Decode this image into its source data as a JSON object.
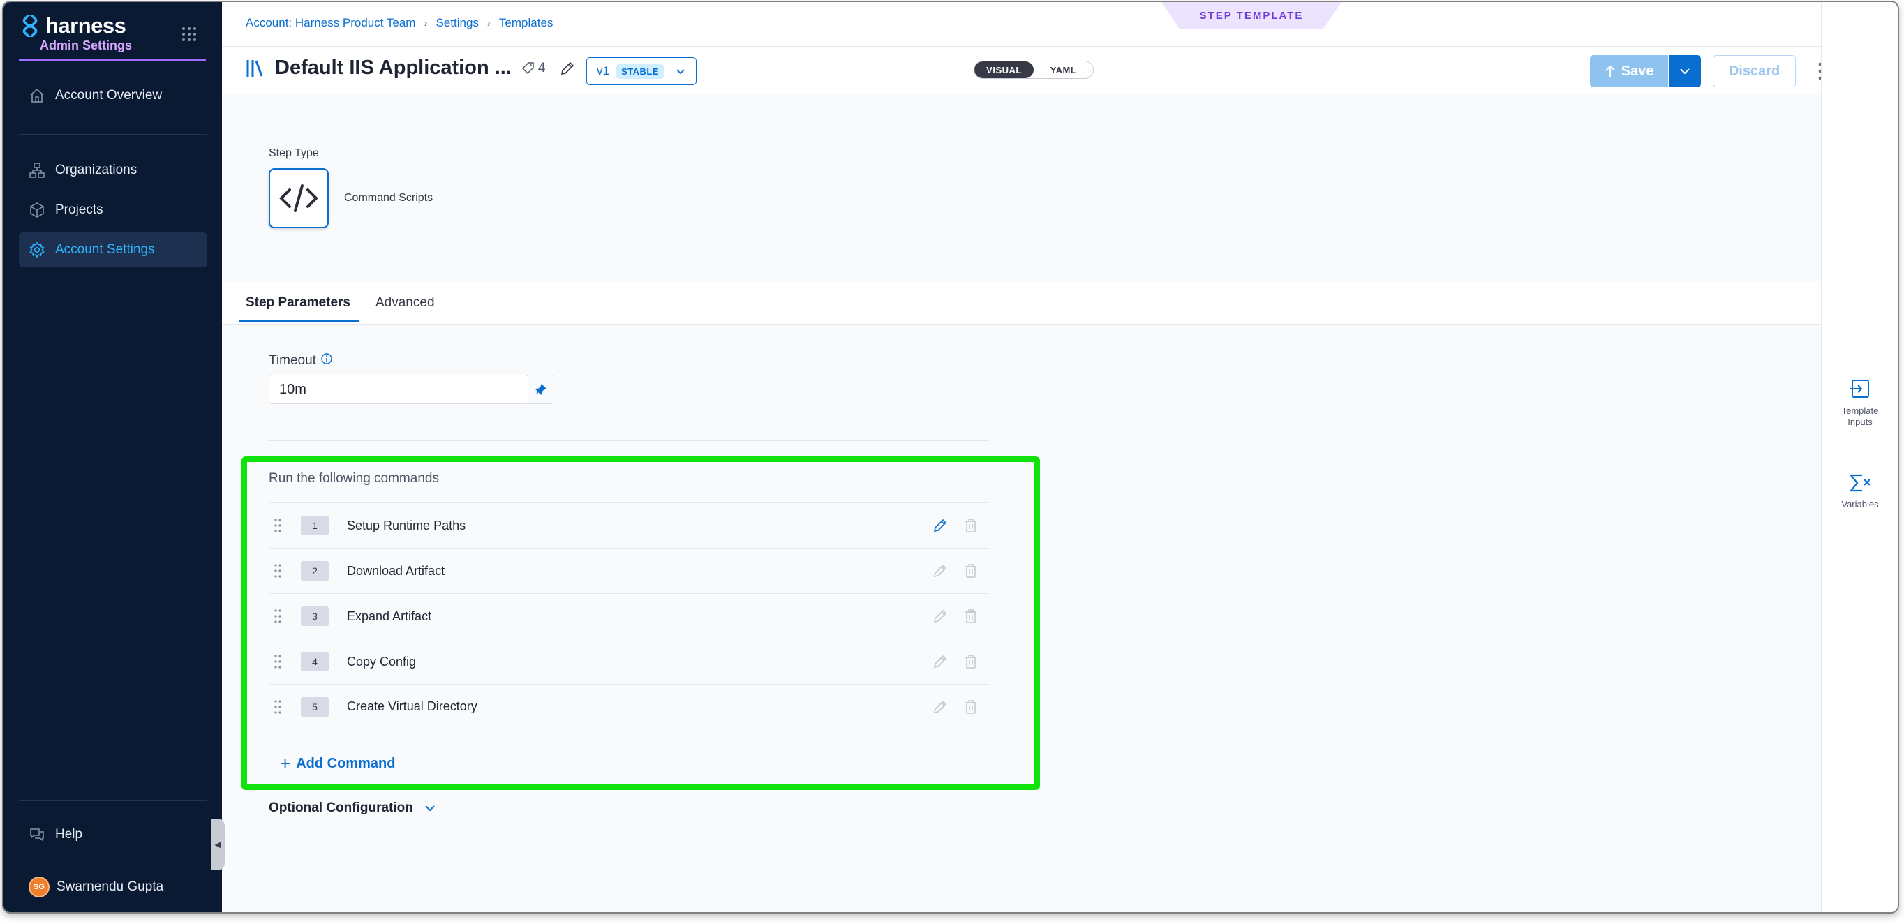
{
  "sidebar": {
    "logo_text": "harness",
    "admin_label": "Admin Settings",
    "items": [
      {
        "label": "Account Overview",
        "icon": "home-icon"
      },
      {
        "label": "Organizations",
        "icon": "org-icon"
      },
      {
        "label": "Projects",
        "icon": "cube-icon"
      },
      {
        "label": "Account Settings",
        "icon": "gear-icon",
        "active": true
      }
    ],
    "help_label": "Help",
    "user": {
      "initials": "SG",
      "name": "Swarnendu Gupta"
    }
  },
  "breadcrumb": {
    "items": [
      "Account: Harness Product Team",
      "Settings",
      "Templates"
    ]
  },
  "template_badge": "STEP TEMPLATE",
  "header": {
    "title": "Default IIS Application ...",
    "tag_count": "4",
    "version": "v1",
    "stable_label": "STABLE",
    "view_toggle": {
      "visual": "VISUAL",
      "yaml": "YAML",
      "selected": "VISUAL"
    },
    "save_label": "Save",
    "discard_label": "Discard"
  },
  "step_type": {
    "label": "Step Type",
    "name": "Command Scripts"
  },
  "tabs": {
    "step_parameters": "Step Parameters",
    "advanced": "Advanced",
    "selected": "Step Parameters"
  },
  "timeout": {
    "label": "Timeout",
    "value": "10m"
  },
  "commands": {
    "title": "Run the following commands",
    "items": [
      {
        "number": "1",
        "name": "Setup Runtime Paths"
      },
      {
        "number": "2",
        "name": "Download Artifact"
      },
      {
        "number": "3",
        "name": "Expand Artifact"
      },
      {
        "number": "4",
        "name": "Copy Config"
      },
      {
        "number": "5",
        "name": "Create Virtual Directory"
      }
    ],
    "add_label": "Add Command"
  },
  "optional_config_label": "Optional Configuration",
  "right_panel": {
    "template_inputs": [
      "Template",
      "Inputs"
    ],
    "variables": "Variables"
  },
  "colors": {
    "sidebar_bg": "#0b1a33",
    "accent_blue": "#0a6ed1",
    "highlight_green": "#0fe30b",
    "admin_purple": "#a06bff"
  }
}
